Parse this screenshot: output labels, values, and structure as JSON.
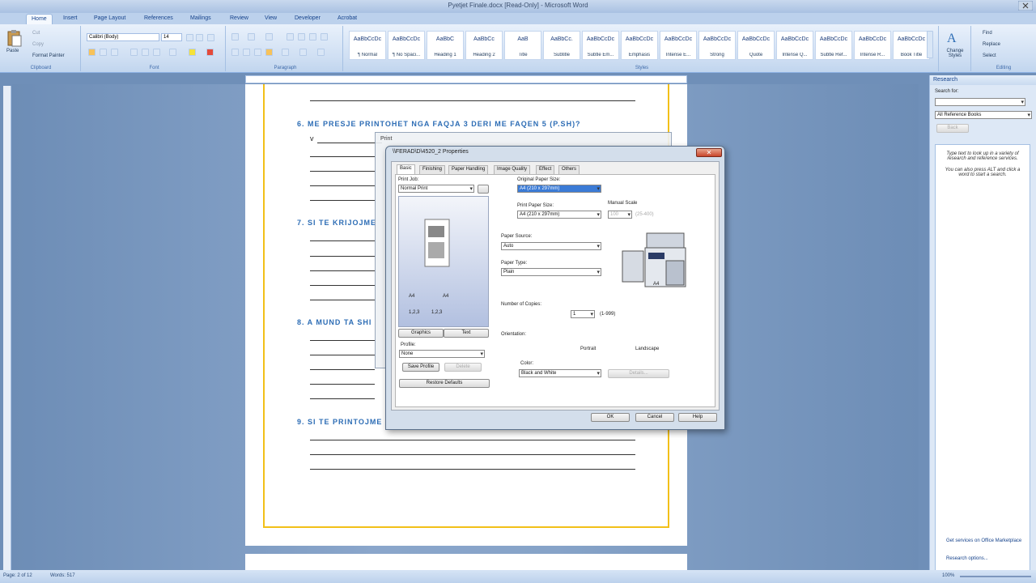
{
  "window": {
    "title": "Pyetjet Finale.docx [Read-Only] - Microsoft Word"
  },
  "tabs": [
    "Home",
    "Insert",
    "Page Layout",
    "References",
    "Mailings",
    "Review",
    "View",
    "Developer",
    "Acrobat"
  ],
  "ribbon": {
    "clipboard": {
      "paste": "Paste",
      "cut": "Cut",
      "copy": "Copy",
      "format_painter": "Format Painter",
      "label": "Clipboard"
    },
    "font": {
      "name": "Calibri (Body)",
      "size": "14",
      "label": "Font"
    },
    "paragraph": {
      "label": "Paragraph"
    },
    "styles": {
      "label": "Styles",
      "items": [
        {
          "preview": "AaBbCcDc",
          "name": "¶ Normal"
        },
        {
          "preview": "AaBbCcDc",
          "name": "¶ No Spaci..."
        },
        {
          "preview": "AaBbC",
          "name": "Heading 1"
        },
        {
          "preview": "AaBbCc",
          "name": "Heading 2"
        },
        {
          "preview": "AaB",
          "name": "Title"
        },
        {
          "preview": "AaBbCc.",
          "name": "Subtitle"
        },
        {
          "preview": "AaBbCcDc",
          "name": "Subtle Em..."
        },
        {
          "preview": "AaBbCcDc",
          "name": "Emphasis"
        },
        {
          "preview": "AaBbCcDc",
          "name": "Intense E..."
        },
        {
          "preview": "AaBbCcDc",
          "name": "Strong"
        },
        {
          "preview": "AaBbCcDc",
          "name": "Quote"
        },
        {
          "preview": "AaBbCcDc",
          "name": "Intense Q..."
        },
        {
          "preview": "AaBbCcDc",
          "name": "Subtle Ref..."
        },
        {
          "preview": "AaBbCcDc",
          "name": "Intense R..."
        },
        {
          "preview": "AaBbCcDc",
          "name": "Book Title"
        }
      ],
      "change_styles": "Change Styles"
    },
    "editing": {
      "find": "Find",
      "replace": "Replace",
      "select": "Select",
      "label": "Editing"
    }
  },
  "document": {
    "q6": "6.  ME  PRESJE  PRINTOHET  NGA  FAQJA  3  DERI  ME  FAQEN  5  (P.SH)?",
    "q6_answer": "v",
    "q7": "7.  SI TE KRIJOJME",
    "q8": "8.  A MUND TA SHI",
    "q9": "9.  SI TE PRINTOJME"
  },
  "research": {
    "title": "Research",
    "search_for": "Search for:",
    "books": "All Reference Books",
    "back": "Back",
    "info1": "Type text to look up in a variety of research and reference services.",
    "info2": "You can also press ALT and click a word to start a search.",
    "get_services": "Get services on Office Marketplace",
    "options": "Research options..."
  },
  "status": {
    "page": "Page: 2 of 12",
    "words": "Words: 517",
    "zoom": "100%"
  },
  "print_dialog": {
    "title": "Print"
  },
  "properties": {
    "title": "\\\\FERAD\\D\\4520_2 Properties",
    "tabs": [
      "Basic",
      "Finishing",
      "Paper Handling",
      "Image Quality",
      "Effect",
      "Others"
    ],
    "print_job_label": "Print Job:",
    "print_job": "Normal Print",
    "orig_paper_label": "Original Paper Size:",
    "orig_paper": "A4 (210 x 297mm)",
    "print_paper_label": "Print Paper Size:",
    "print_paper": "A4 (210 x 297mm)",
    "manual_scale": "Manual Scale",
    "scale_value": "100",
    "scale_range": "(25-400)",
    "paper_source_label": "Paper Source:",
    "paper_source": "Auto",
    "paper_type_label": "Paper Type:",
    "paper_type": "Plain",
    "copies_label": "Number of Copies:",
    "copies": "1",
    "copies_range": "(1-999)",
    "orientation_label": "Orientation:",
    "portrait": "Portrait",
    "landscape": "Landscape",
    "color_label": "Color:",
    "color": "Black and White",
    "details": "Details...",
    "graphics": "Graphics",
    "text": "Text",
    "profile_label": "Profile:",
    "profile": "None",
    "save_profile": "Save Profile",
    "delete": "Delete",
    "restore": "Restore Defaults",
    "a4_left": "A4",
    "a4_right": "A4",
    "pages_left": "1,2,3",
    "pages_right": "1,2,3",
    "tray_a4": "A4",
    "ok": "OK",
    "cancel": "Cancel",
    "help": "Help"
  }
}
